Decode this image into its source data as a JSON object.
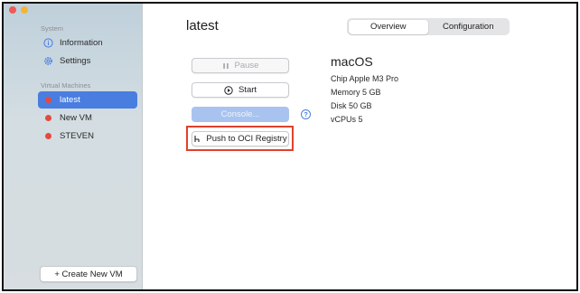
{
  "sidebar": {
    "system_label": "System",
    "system_items": [
      {
        "label": "Information",
        "icon": "info-icon"
      },
      {
        "label": "Settings",
        "icon": "gear-icon"
      }
    ],
    "vm_label": "Virtual Machines",
    "vms": [
      {
        "label": "latest",
        "selected": true
      },
      {
        "label": "New VM",
        "selected": false
      },
      {
        "label": "STEVEN",
        "selected": false
      }
    ],
    "create_label": "+ Create New VM"
  },
  "main": {
    "title": "latest",
    "tabs": [
      {
        "label": "Overview",
        "selected": true
      },
      {
        "label": "Configuration",
        "selected": false
      }
    ],
    "actions": {
      "pause": "Pause",
      "start": "Start",
      "console": "Console...",
      "push": "Push to OCI Registry"
    },
    "details": {
      "os": "macOS",
      "chip": "Chip Apple M3 Pro",
      "memory": "Memory 5 GB",
      "disk": "Disk 50 GB",
      "cpus": "vCPUs 5"
    }
  },
  "colors": {
    "accent": "#4a7de0",
    "status_dot": "#e24b3e",
    "highlight_box": "#e0412d"
  }
}
